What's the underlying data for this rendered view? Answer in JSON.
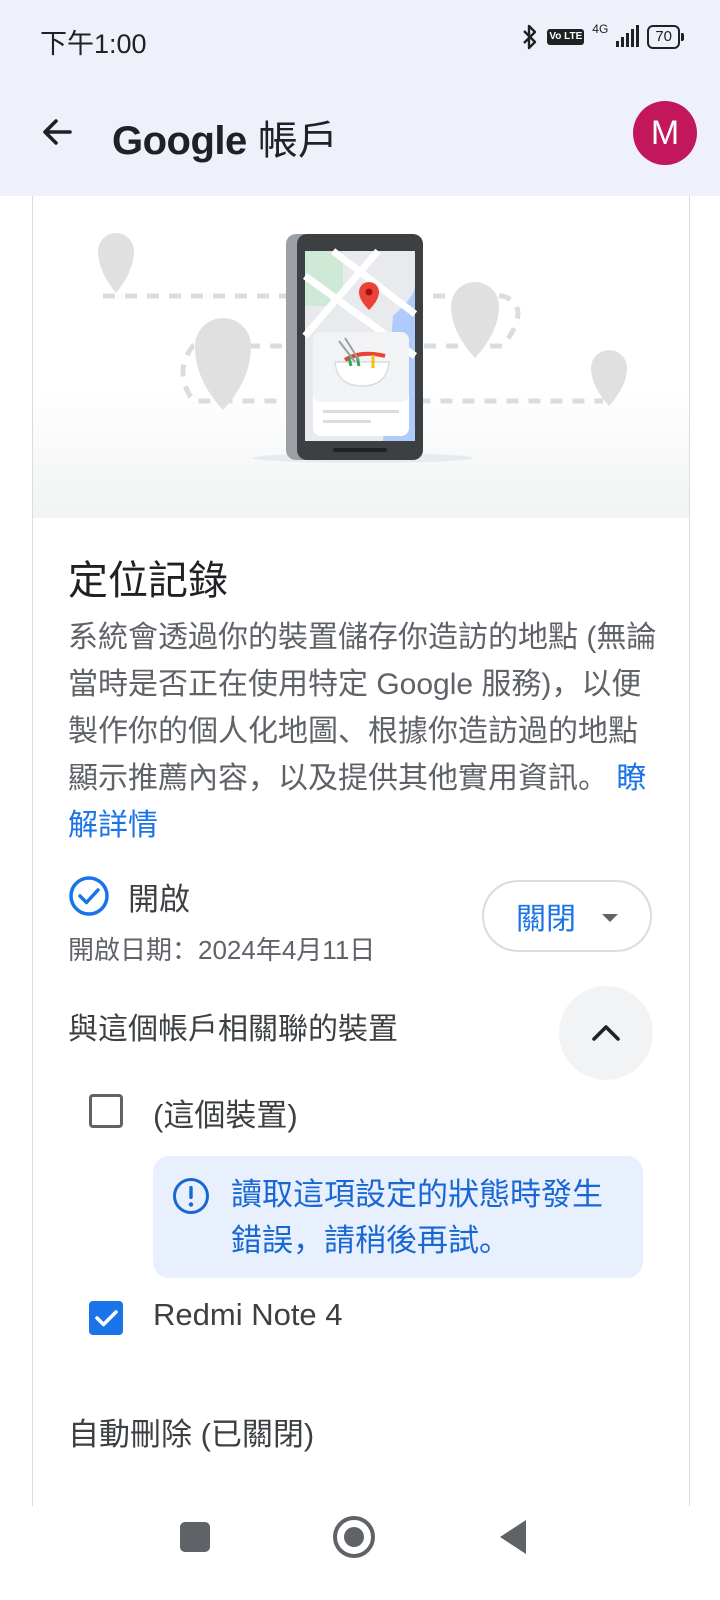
{
  "status_bar": {
    "time": "下午1:00",
    "volte": "Vo LTE",
    "network": "4G",
    "battery": "70"
  },
  "app_bar": {
    "title_brand": "Google",
    "title_suffix": " 帳戶",
    "avatar_letter": "M",
    "avatar_color": "#c2185b",
    "back_icon": "arrow-back-icon"
  },
  "location_history": {
    "title": "定位記錄",
    "description": "系統會透過你的裝置儲存你造訪的地點 (無論當時是否正在使用特定 Google 服務)，以便製作你的個人化地圖、根據你造訪過的地點顯示推薦內容，以及提供其他實用資訊。",
    "learn_more": "瞭解詳情",
    "status_label": "開啟",
    "enabled_date": "開啟日期：2024年4月11日",
    "toggle_button": "關閉"
  },
  "devices": {
    "title": "與這個帳戶相關聯的裝置",
    "items": [
      {
        "label": "(這個裝置)",
        "checked": false,
        "error": "讀取這項設定的狀態時發生錯誤，請稍後再試。"
      },
      {
        "label": "Redmi Note 4",
        "checked": true
      }
    ]
  },
  "auto_delete": {
    "label": "自動刪除 (已關閉)"
  },
  "colors": {
    "accent": "#1a73e8",
    "header_bg": "#eef1fa",
    "alert_bg": "#e8f0fe"
  }
}
